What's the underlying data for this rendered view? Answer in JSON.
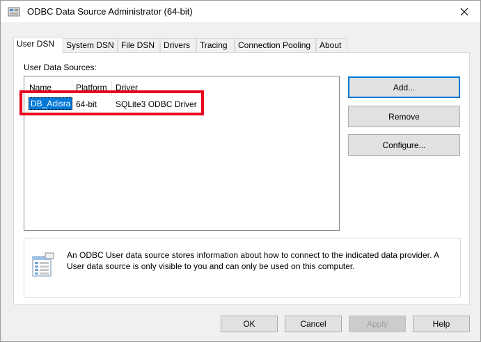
{
  "window": {
    "title": "ODBC Data Source Administrator (64-bit)",
    "close_label": "Close"
  },
  "tabs": [
    {
      "label": "User DSN",
      "active": true
    },
    {
      "label": "System DSN",
      "active": false
    },
    {
      "label": "File DSN",
      "active": false
    },
    {
      "label": "Drivers",
      "active": false
    },
    {
      "label": "Tracing",
      "active": false
    },
    {
      "label": "Connection Pooling",
      "active": false
    },
    {
      "label": "About",
      "active": false
    }
  ],
  "user_dsn": {
    "section_label": "User Data Sources:",
    "columns": [
      "Name",
      "Platform",
      "Driver"
    ],
    "rows": [
      {
        "name": "DB_Adisra",
        "platform": "64-bit",
        "driver": "SQLite3 ODBC Driver",
        "selected": true
      }
    ],
    "buttons": {
      "add": "Add...",
      "remove": "Remove",
      "configure": "Configure..."
    },
    "info_text": "An ODBC User data source stores information about how to connect to the indicated data provider.  A User data source is only visible to you and can only be used on this computer."
  },
  "footer": {
    "ok": "OK",
    "cancel": "Cancel",
    "apply": "Apply",
    "help": "Help"
  },
  "colors": {
    "selection": "#0078d7",
    "highlight_box": "#e8001c",
    "default_button_border": "#0078d7"
  }
}
